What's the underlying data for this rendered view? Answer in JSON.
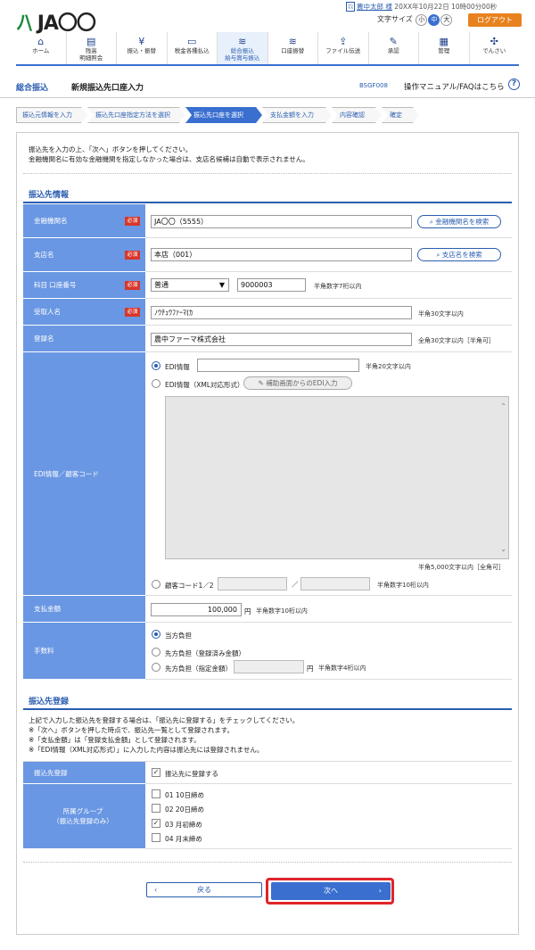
{
  "header": {
    "logo": "JA〇〇",
    "user_badge": "ﾏｽ",
    "user_name": "農中太郎 様",
    "datetime": "20XX年10月22日 10時00分00秒",
    "font_size_label": "文字サイズ",
    "font_sizes": [
      "小",
      "中",
      "大"
    ],
    "logout": "ログアウト"
  },
  "nav": [
    {
      "label": "ホーム",
      "icon": "house-icon"
    },
    {
      "label": "残高\n明細照会",
      "icon": "document-icon"
    },
    {
      "label": "振込・振替",
      "icon": "yen-coin-icon"
    },
    {
      "label": "税金各種払込",
      "icon": "card-icon"
    },
    {
      "label": "総合振込\n給与賞与振込",
      "icon": "coin-stack-icon"
    },
    {
      "label": "口座振替",
      "icon": "coin-stack-icon"
    },
    {
      "label": "ファイル伝送",
      "icon": "file-transfer-icon"
    },
    {
      "label": "承認",
      "icon": "approval-icon"
    },
    {
      "label": "管理",
      "icon": "admin-icon"
    },
    {
      "label": "でんさい",
      "icon": "densai-icon"
    }
  ],
  "title": {
    "category": "総合振込",
    "page": "新規振込先口座入力",
    "screen_code": "BSGF008",
    "manual": "操作マニュアル/FAQはこちら"
  },
  "steps": [
    "振込元情報を入力",
    "振込先口座指定方法を選択",
    "振込先口座を選択",
    "支払金額を入力",
    "内容確認",
    "確定"
  ],
  "intro": [
    "振込先を入力の上、「次へ」ボタンを押してください。",
    "金融機関名に有効な金融機関を指定しなかった場合は、支店名候補は自動で表示されません。"
  ],
  "payee_section": {
    "title": "振込先情報",
    "required": "必須",
    "bank_label": "金融機関名",
    "bank_value": "JA〇〇（5555）",
    "bank_search": "金融機関名を検索",
    "branch_label": "支店名",
    "branch_value": "本店（001）",
    "branch_search": "支店名を検索",
    "account_label": "科目 口座番号",
    "account_type": "普通",
    "account_number": "9000003",
    "account_hint": "半角数字7桁以内",
    "recipient_label": "受取人名",
    "recipient_value": "ﾉｳﾁｭｳﾌｧｰﾏ(ｶ",
    "recipient_hint": "半角30文字以内",
    "regname_label": "登録名",
    "regname_value": "農中ファーマ株式会社",
    "regname_hint": "全角30文字以内［半角可］",
    "edi_label": "EDI情報／顧客コード",
    "edi_option": "EDI情報",
    "edi_hint": "半角20文字以内",
    "edi_xml_option": "EDI情報（XML対応形式）",
    "edi_assist_button": "補助画面からのEDI入力",
    "edi_textarea_hint": "半角5,000文字以内［全角可］",
    "customer_code_option": "顧客コード1／2",
    "customer_code_sep": "／",
    "customer_code_hint": "半角数字10桁以内",
    "amount_label": "支払金額",
    "amount_value": "100,000",
    "amount_unit": "円",
    "amount_hint": "半角数字10桁以内",
    "fee_label": "手数料",
    "fee_options": [
      "当方負担",
      "先方負担（登録済み金額）",
      "先方負担（指定金額）"
    ],
    "fee_unit": "円",
    "fee_hint": "半角数字4桁以内"
  },
  "register_section": {
    "title": "振込先登録",
    "notes": [
      "上記で入力した振込先を登録する場合は、「振込先に登録する」をチェックしてください。",
      "※「次へ」ボタンを押した時点で、振込先一覧として登録されます。",
      "※「支払金額」は「登録支払金額」として登録されます。",
      "※「EDI情報（XML対応形式）」に入力した内容は振込先には登録されません。"
    ],
    "register_label": "振込先登録",
    "register_checkbox": "振込先に登録する",
    "group_label": "所属グループ\n（振込先登録のみ）",
    "groups": [
      {
        "label": "01 10日締め",
        "checked": false
      },
      {
        "label": "02 20日締め",
        "checked": false
      },
      {
        "label": "03 月初締め",
        "checked": true
      },
      {
        "label": "04 月末締め",
        "checked": false
      }
    ]
  },
  "footer": {
    "back": "戻る",
    "next": "次へ"
  }
}
